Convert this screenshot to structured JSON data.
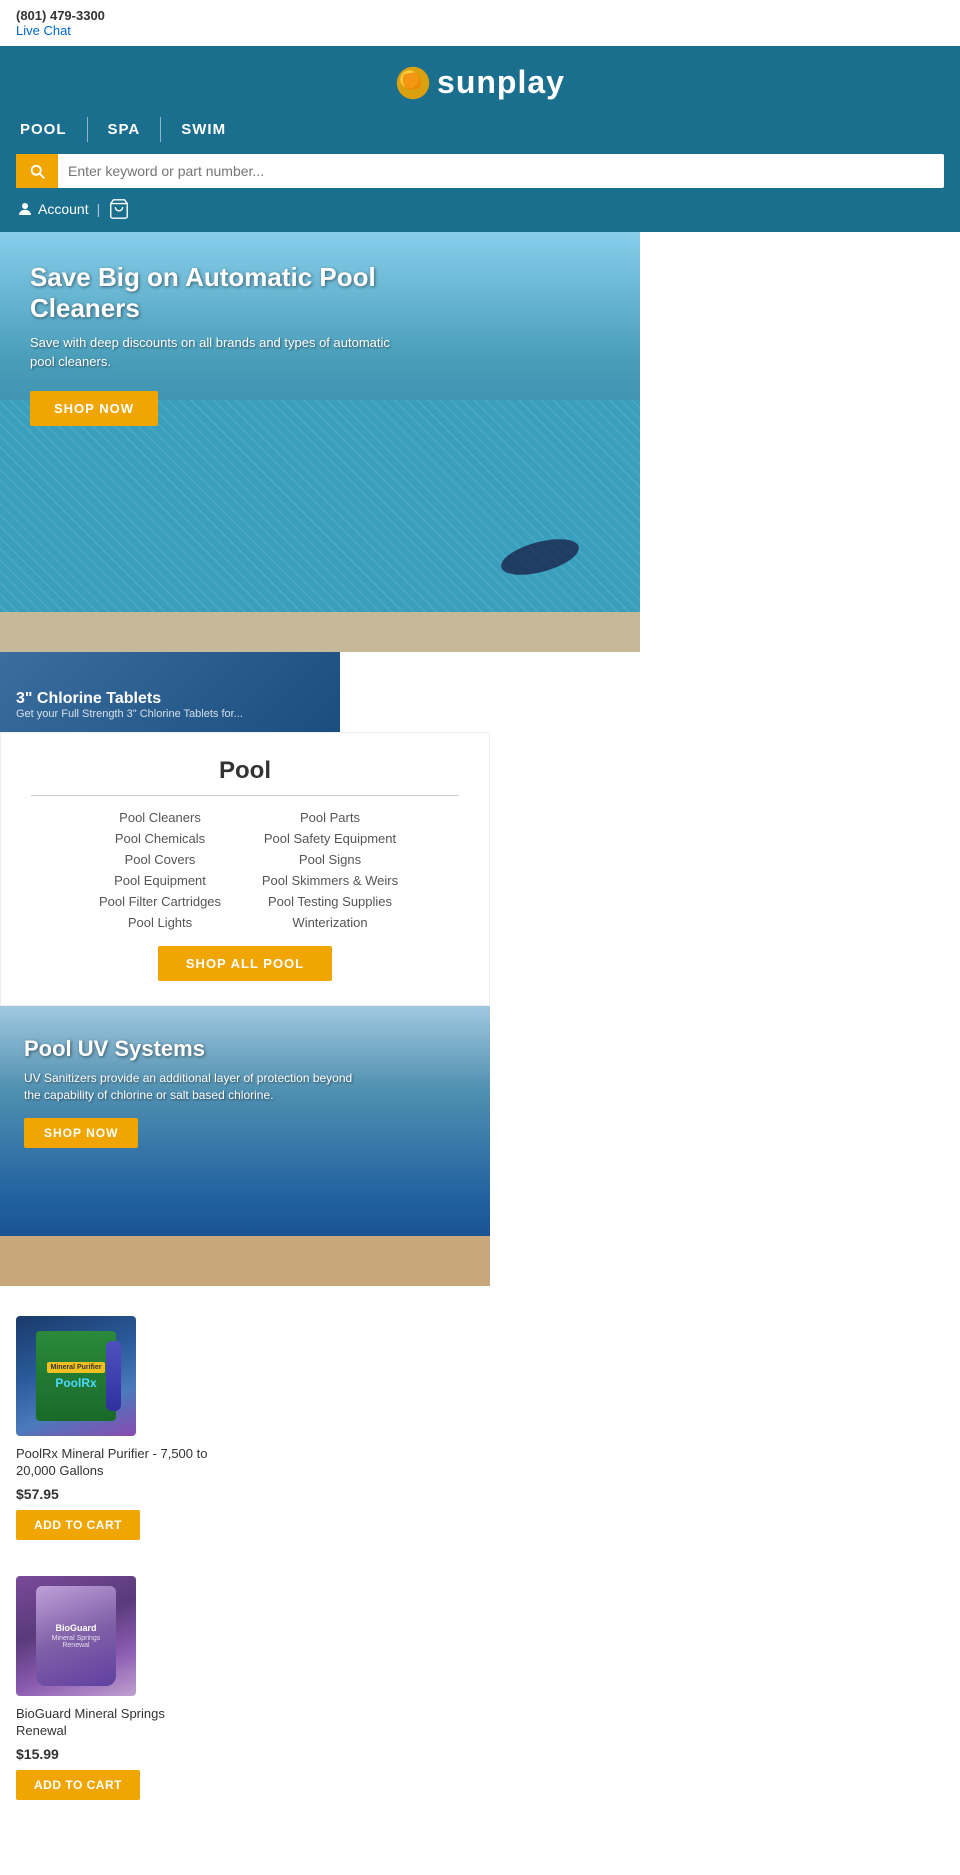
{
  "topbar": {
    "phone": "(801) 479-3300",
    "chat": "Live Chat"
  },
  "header": {
    "logo_text": "sunplay",
    "nav": [
      {
        "label": "POOL",
        "id": "pool"
      },
      {
        "label": "SPA",
        "id": "spa"
      },
      {
        "label": "SWIM",
        "id": "swim"
      }
    ],
    "search_placeholder": "Enter keyword or part number...",
    "account_label": "Account"
  },
  "hero": {
    "title": "Save Big on Automatic Pool Cleaners",
    "subtitle": "Save with deep discounts on all brands and types of automatic pool cleaners.",
    "btn_label": "SHOP NOW"
  },
  "chlorine_banner": {
    "title": "3\" Chlorine Tablets",
    "subtitle": "Get your Full Strength 3\" Chlorine Tablets for..."
  },
  "pool_section": {
    "title": "Pool",
    "categories_left": [
      "Pool Cleaners",
      "Pool Chemicals",
      "Pool Covers",
      "Pool Equipment",
      "Pool Filter Cartridges",
      "Pool Lights"
    ],
    "categories_right": [
      "Pool Parts",
      "Pool Safety Equipment",
      "Pool Signs",
      "Pool Skimmers & Weirs",
      "Pool Testing Supplies",
      "Winterization"
    ],
    "shop_all_label": "SHOP ALL POOL"
  },
  "uv_banner": {
    "title": "Pool UV Systems",
    "subtitle": "UV Sanitizers provide an additional layer of protection beyond the capability of chlorine or salt based chlorine.",
    "btn_label": "SHOP NOW"
  },
  "products": [
    {
      "name": "PoolRx Mineral Purifier - 7,500 to 20,000 Gallons",
      "price": "$57.95",
      "add_label": "ADD TO CART",
      "img_type": "poolrx"
    },
    {
      "name": "BioGuard Mineral Springs Renewal",
      "price": "$15.99",
      "add_label": "ADD TO CART",
      "img_type": "bioguard"
    }
  ]
}
